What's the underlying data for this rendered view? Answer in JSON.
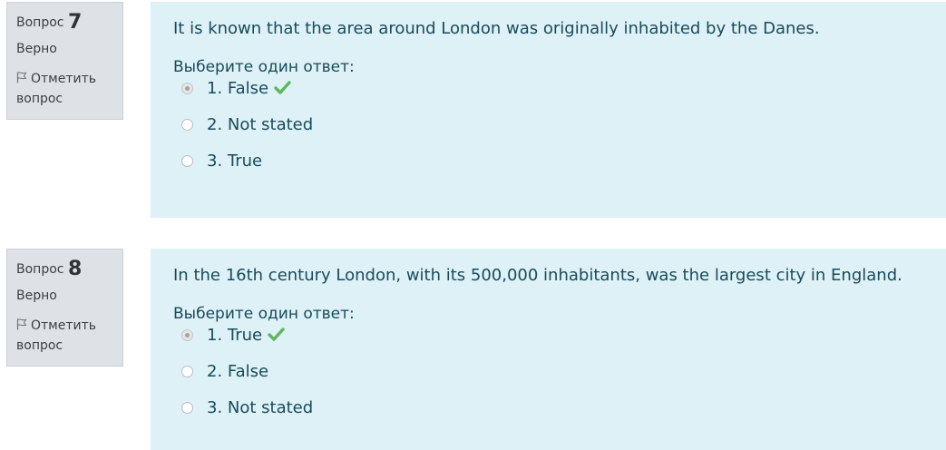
{
  "questions": [
    {
      "label": "Вопрос",
      "number": "7",
      "state": "Верно",
      "flag_label": "Отметить вопрос",
      "text": "It is known that the area around London was originally inhabited by the Danes.",
      "prompt": "Выберите один ответ:",
      "answers": [
        {
          "label": "1. False",
          "checked": true,
          "correct": true
        },
        {
          "label": "2. Not stated",
          "checked": false,
          "correct": false
        },
        {
          "label": "3. True",
          "checked": false,
          "correct": false
        }
      ]
    },
    {
      "label": "Вопрос",
      "number": "8",
      "state": "Верно",
      "flag_label": "Отметить вопрос",
      "text": "In the 16th century London, with its 500,000 inhabitants, was the largest city in England.",
      "prompt": "Выберите один ответ:",
      "answers": [
        {
          "label": "1. True",
          "checked": true,
          "correct": true
        },
        {
          "label": "2. False",
          "checked": false,
          "correct": false
        },
        {
          "label": "3. Not stated",
          "checked": false,
          "correct": false
        }
      ]
    }
  ],
  "colors": {
    "info_bg": "#dee2e6",
    "content_bg": "#def1f7",
    "text": "#184b5a",
    "correct_check": "#5cb85c"
  },
  "icons": {
    "flag": "flag-icon",
    "correct": "check-icon"
  }
}
